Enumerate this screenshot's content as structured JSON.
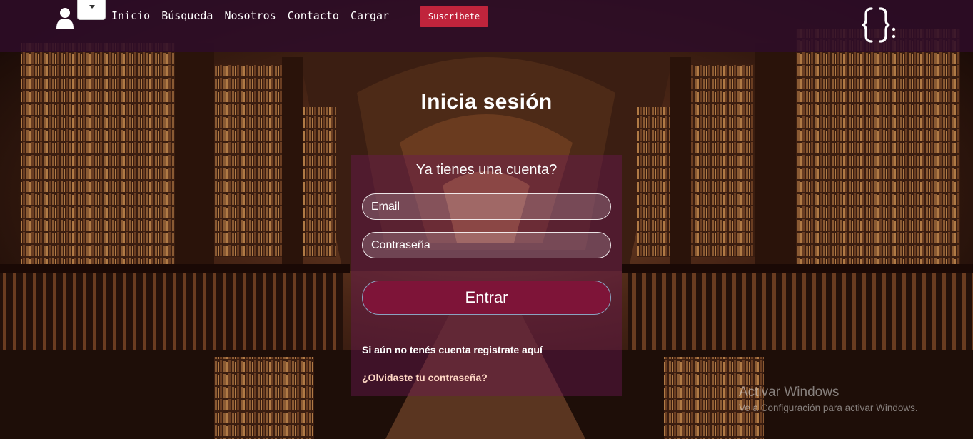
{
  "nav": {
    "links": [
      "Inicio",
      "Búsqueda",
      "Nosotros",
      "Contacto",
      "Cargar"
    ],
    "subscribe_label": "Suscribete"
  },
  "login": {
    "title": "Inicia sesión",
    "question": "Ya tienes una cuenta?",
    "email_placeholder": "Email",
    "password_placeholder": "Contraseña",
    "submit_label": "Entrar",
    "register_text": "Si aún no tenés cuenta registrate aquí",
    "forgot_label": "¿Olvidaste tu contraseña?"
  },
  "watermark": {
    "title": "Activar Windows",
    "subtitle": "Ve a Configuración para activar Windows."
  },
  "icons": {
    "user": "user-icon",
    "dropdown": "caret-down-icon",
    "logo": "curly-braces-logo"
  },
  "colors": {
    "navbar": "#2d0c28",
    "subscribe": "#c0243c",
    "submit": "#7e1438",
    "panel": "#6e1955"
  }
}
